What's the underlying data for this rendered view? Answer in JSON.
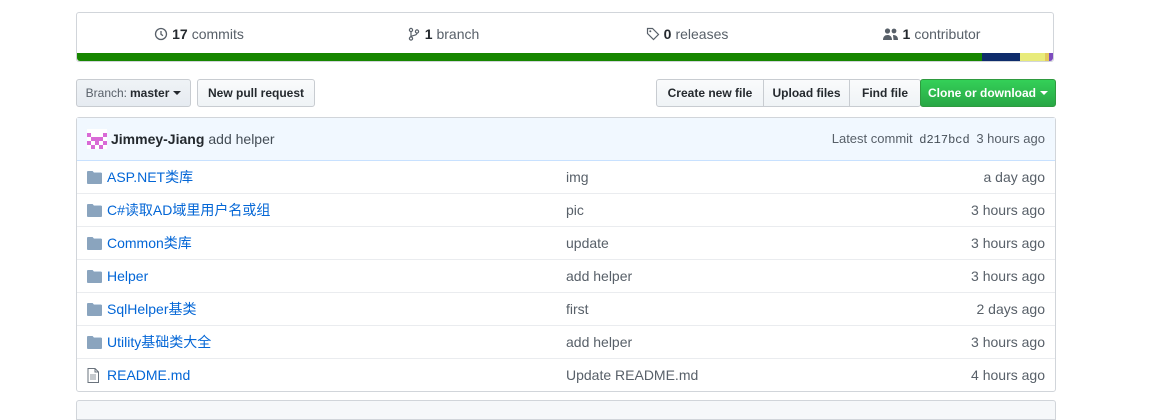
{
  "summary": {
    "commits_count": "17",
    "commits_label": "commits",
    "branch_count": "1",
    "branch_label": "branch",
    "releases_count": "0",
    "releases_label": "releases",
    "contributor_count": "1",
    "contributor_label": "contributor",
    "language_colors": [
      "#178600",
      "#0e2c6b",
      "#e8eb7a",
      "#e3c95d",
      "#7d4cbe"
    ]
  },
  "toolbar": {
    "branch_prefix": "Branch:",
    "branch_name": "master",
    "new_pr_label": "New pull request",
    "create_file_label": "Create new file",
    "upload_label": "Upload files",
    "find_label": "Find file",
    "clone_label": "Clone or download"
  },
  "latest_commit": {
    "author": "Jimmey-Jiang",
    "message": "add helper",
    "prefix": "Latest commit",
    "sha": "d217bcd",
    "age": "3 hours ago"
  },
  "files": [
    {
      "name": "ASP.NET类库",
      "message": "img",
      "age": "a day ago",
      "icon": "folder-icon"
    },
    {
      "name": "C#读取AD域里用户名或组",
      "message": "pic",
      "age": "3 hours ago",
      "icon": "folder-icon"
    },
    {
      "name": "Common类库",
      "message": "update",
      "age": "3 hours ago",
      "icon": "folder-icon"
    },
    {
      "name": "Helper",
      "message": "add helper",
      "age": "3 hours ago",
      "icon": "folder-icon"
    },
    {
      "name": "SqlHelper基类",
      "message": "first",
      "age": "2 days ago",
      "icon": "folder-icon"
    },
    {
      "name": "Utility基础类大全",
      "message": "add helper",
      "age": "3 hours ago",
      "icon": "folder-icon"
    },
    {
      "name": "README.md",
      "message": "Update README.md",
      "age": "4 hours ago",
      "icon": "file-icon"
    }
  ]
}
